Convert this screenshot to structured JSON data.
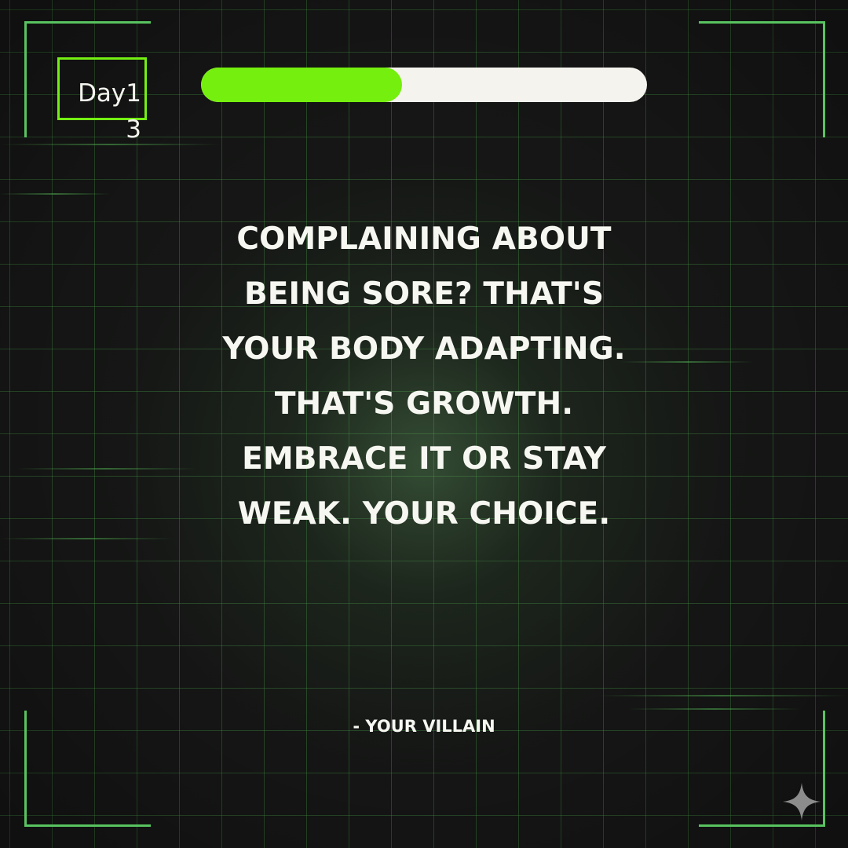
{
  "day_badge": {
    "label": "Day13"
  },
  "progress": {
    "value": 45
  },
  "quote": {
    "text": "COMPLAINING ABOUT\nBEING SORE? THAT'S\nYOUR BODY ADAPTING.\nTHAT'S GROWTH.\nEMBRACE IT OR STAY\nWEAK. YOUR CHOICE."
  },
  "attribution": {
    "text": "- YOUR VILLAIN"
  },
  "colors": {
    "accent": "#75ef0d",
    "frame": "#58c35f",
    "text": "#f7f7f2",
    "background": "#171817"
  },
  "icons": {
    "sparkle": "sparkle-icon"
  }
}
